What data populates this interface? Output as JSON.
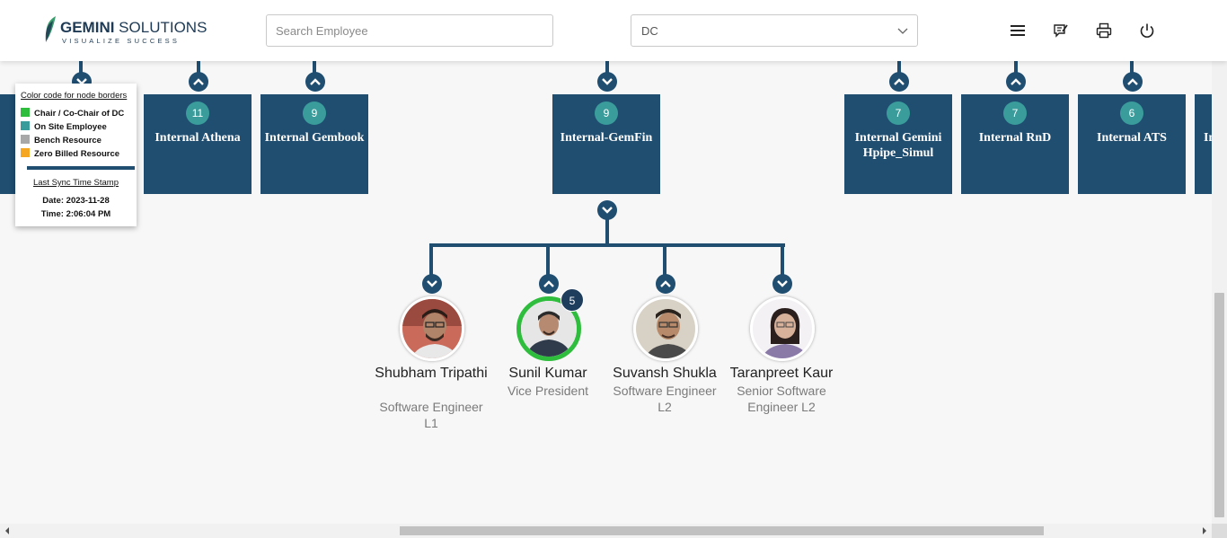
{
  "header": {
    "logo": {
      "brand_bold": "GEMINI",
      "brand_rest": " SOLUTIONS",
      "tagline": "VISUALIZE SUCCESS"
    },
    "search": {
      "placeholder": "Search Employee",
      "value": ""
    },
    "unit_select": {
      "value": "DC"
    },
    "icons": [
      "menu-icon",
      "feedback-icon",
      "print-icon",
      "power-icon"
    ]
  },
  "legend": {
    "title": "Color code for node borders",
    "items": [
      {
        "label": "Chair / Co-Chair of DC",
        "color": "#2fbd3d"
      },
      {
        "label": "On Site Employee",
        "color": "#3a9c9b"
      },
      {
        "label": "Bench Resource",
        "color": "#a8a8a8"
      },
      {
        "label": "Zero Billed Resource",
        "color": "#f5a623"
      }
    ],
    "sync_title": "Last Sync Time Stamp",
    "sync_date": "Date: 2023-11-28",
    "sync_time": "Time: 2:06:04 PM"
  },
  "nodes": [
    {
      "count": "11",
      "title": "Internal Athena"
    },
    {
      "count": "9",
      "title": "Internal Gembook"
    },
    {
      "count": "9",
      "title": "Internal-GemFin"
    },
    {
      "count": "7",
      "title": "Internal Gemini Hpipe_Simul"
    },
    {
      "count": "7",
      "title": "Internal RnD"
    },
    {
      "count": "6",
      "title": "Internal ATS"
    },
    {
      "title": "In"
    }
  ],
  "people": [
    {
      "name": "Shubham Tripathi",
      "role": "Software Engineer L1"
    },
    {
      "name": "Sunil Kumar",
      "role": "Vice President",
      "reports": "5"
    },
    {
      "name": "Suvansh Shukla",
      "role": "Software Engineer L2"
    },
    {
      "name": "Taranpreet Kaur",
      "role": "Senior Software Engineer L2"
    }
  ],
  "colors": {
    "node": "#1f4e71",
    "badge": "#3a9c9b",
    "chair": "#2fbd3d"
  }
}
